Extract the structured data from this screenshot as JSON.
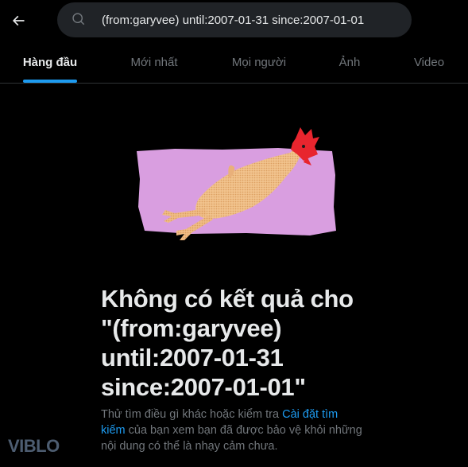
{
  "search": {
    "value": "(from:garyvee) until:2007-01-31 since:2007-01-01"
  },
  "tabs": [
    {
      "label": "Hàng đầu",
      "active": true
    },
    {
      "label": "Mới nhất",
      "active": false
    },
    {
      "label": "Mọi người",
      "active": false
    },
    {
      "label": "Ảnh",
      "active": false
    },
    {
      "label": "Video",
      "active": false
    }
  ],
  "empty_state": {
    "title": "Không có kết quả cho \"(from:garyvee) until:2007-01-31 since:2007-01-01\"",
    "desc_before": "Thử tìm điều gì khác hoặc kiểm tra ",
    "desc_link": "Cài đặt tìm kiếm",
    "desc_after": " của bạn xem bạn đã được bảo vệ khỏi những nội dung có thể là nhạy cảm chưa."
  },
  "watermark": "VIBLO",
  "colors": {
    "background": "#000000",
    "accent": "#1d9bf0",
    "text_primary": "#e7e9ea",
    "text_secondary": "#71767b",
    "search_bg": "#202327",
    "illustration_bg": "#d99ee0"
  },
  "icons": {
    "back": "arrow-left-icon",
    "search": "search-icon"
  }
}
